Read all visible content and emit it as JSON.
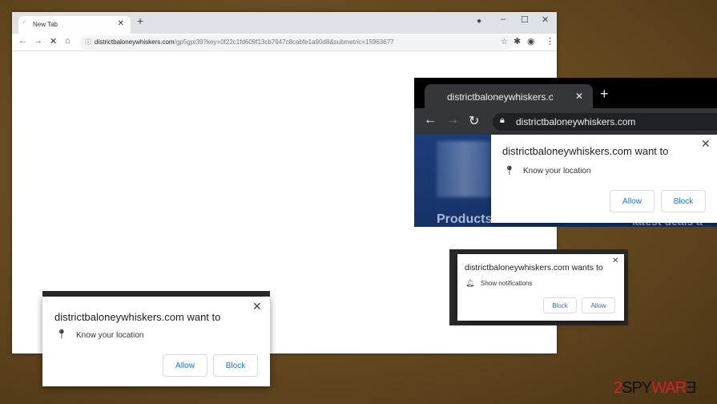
{
  "main_browser": {
    "tab_title": "New Tab",
    "url_domain": "districtbaloneywhiskers.com",
    "url_path": "/gp5gpr39?key=0f22c1fd609f13cb7947c8cabfe1a90d8&submetric=15963677"
  },
  "dark_browser": {
    "tab_title": "districtbaloneywhiskers.c",
    "url": "districtbaloneywhiskers.com",
    "page_text_1": "Products",
    "page_text_2": "latest deals a"
  },
  "location_popup": {
    "title": "districtbaloneywhiskers.com want to",
    "item": "Know your location",
    "allow": "Allow",
    "block": "Block"
  },
  "notification_popup": {
    "title": "districtbaloneywhiskers.com wants to",
    "item": "Show notifications",
    "block": "Block",
    "allow": "Allow"
  },
  "watermark": "2SPYWARE",
  "colors": {
    "background": "#6b4f24",
    "button_text": "#1a73e8",
    "watermark_red": "#d4202a"
  }
}
